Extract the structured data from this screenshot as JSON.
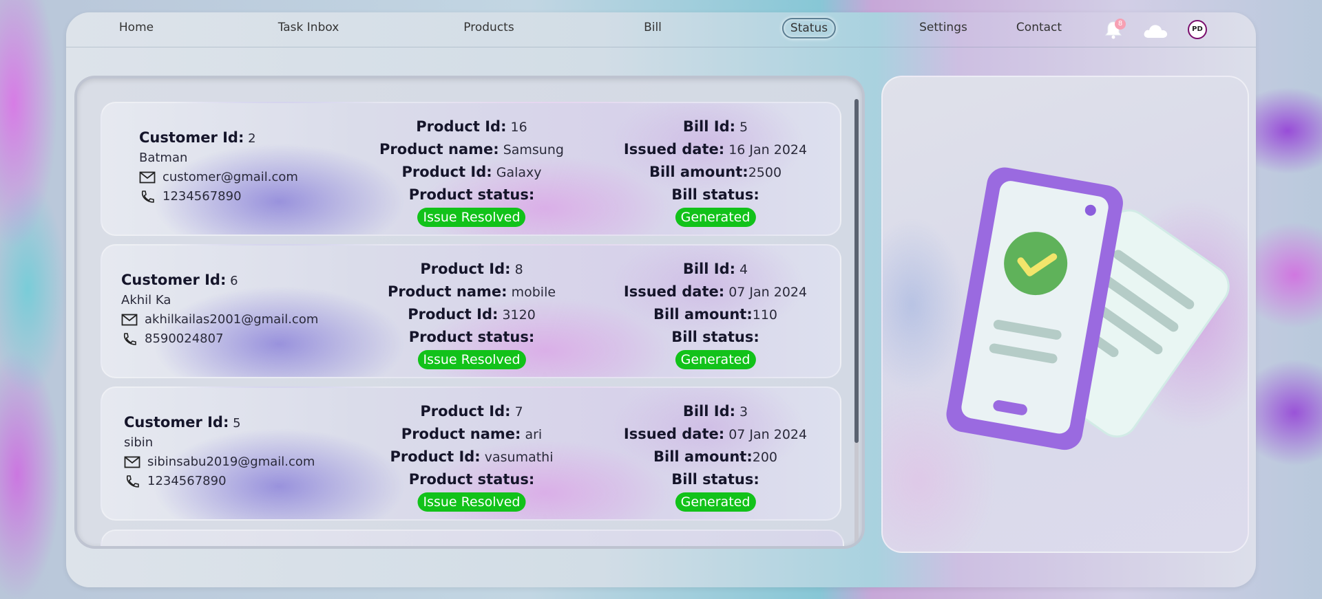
{
  "nav": {
    "items": [
      "Home",
      "Task Inbox",
      "Products",
      "Bill",
      "Status",
      "Settings",
      "Contact"
    ],
    "active": "Status",
    "notification_count": "8",
    "avatar_initials": "PD"
  },
  "labels": {
    "customer_id": "Customer Id:",
    "product_id": "Product Id:",
    "product_name": "Product name:",
    "product_status": "Product status:",
    "bill_id": "Bill Id:",
    "issued_date": "Issued date:",
    "bill_amount": "Bill amount:",
    "bill_status": "Bill status:"
  },
  "cards": [
    {
      "customer_id": "2",
      "name": "Batman",
      "email": "customer@gmail.com",
      "phone": "1234567890",
      "product_id": "16",
      "product_name": "Samsung",
      "product_id_2": "Galaxy",
      "product_status": "Issue Resolved",
      "bill_id": "5",
      "issued_date": "16 Jan 2024",
      "bill_amount": "2500",
      "bill_status": "Generated"
    },
    {
      "customer_id": "6",
      "name": "Akhil Ka",
      "email": "akhilkailas2001@gmail.com",
      "phone": "8590024807",
      "product_id": "8",
      "product_name": "mobile",
      "product_id_2": "3120",
      "product_status": "Issue Resolved",
      "bill_id": "4",
      "issued_date": "07 Jan 2024",
      "bill_amount": "110",
      "bill_status": "Generated"
    },
    {
      "customer_id": "5",
      "name": "sibin",
      "email": "sibinsabu2019@gmail.com",
      "phone": "1234567890",
      "product_id": "7",
      "product_name": "ari",
      "product_id_2": "vasumathi",
      "product_status": "Issue Resolved",
      "bill_id": "3",
      "issued_date": "07 Jan 2024",
      "bill_amount": "200",
      "bill_status": "Generated"
    }
  ],
  "icons": {
    "bell": "bell-icon",
    "cloud": "cloud-icon",
    "mail": "mail-icon",
    "phone": "phone-icon",
    "illustration": "phone-with-checkmark-and-document-illustration"
  },
  "colors": {
    "status_badge": "#12c21a",
    "active_nav_border": "#5d7f93",
    "notification_badge": "#f7a0b3",
    "avatar_border": "#7a0d6c",
    "phone_frame": "#9a6ae0",
    "check_circle": "#5fb25a"
  }
}
